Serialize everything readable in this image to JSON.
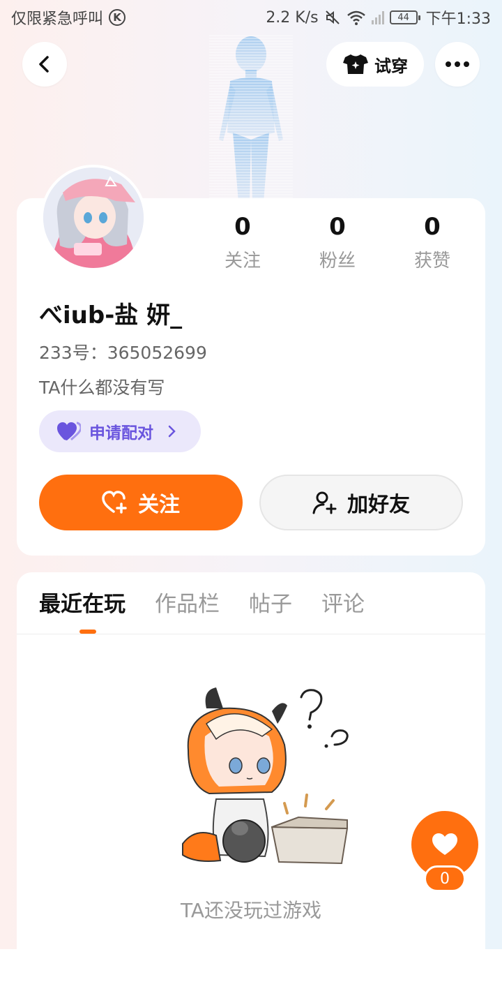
{
  "status_bar": {
    "left_text": "仅限紧急呼叫",
    "left_badge": "K",
    "speed": "2.2 K/s",
    "battery": "44",
    "time": "下午1:33"
  },
  "header": {
    "try_on_label": "试穿"
  },
  "profile": {
    "stats": [
      {
        "value": "0",
        "label": "关注"
      },
      {
        "value": "0",
        "label": "粉丝"
      },
      {
        "value": "0",
        "label": "获赞"
      }
    ],
    "username": "べiub-盐 妍_",
    "uid": "233号：365052699",
    "bio": "TA什么都没有写",
    "pair_label": "申请配对",
    "follow_label": "关注",
    "add_friend_label": "加好友"
  },
  "tabs": [
    {
      "label": "最近在玩",
      "active": true
    },
    {
      "label": "作品栏",
      "active": false
    },
    {
      "label": "帖子",
      "active": false
    },
    {
      "label": "评论",
      "active": false
    }
  ],
  "empty_state": {
    "text": "TA还没玩过游戏"
  },
  "like_fab": {
    "count": "0"
  },
  "colors": {
    "accent": "#ff6f0f",
    "pair_purple": "#6a55de",
    "pair_bg": "#ebe8fb"
  },
  "icons": [
    "back-arrow-icon",
    "tshirt-sparkle-icon",
    "more-dots-icon",
    "heart-pair-icon",
    "chevron-right-icon",
    "heart-plus-icon",
    "person-plus-icon",
    "heart-icon",
    "mute-icon",
    "wifi-icon",
    "signal-icon",
    "battery-icon"
  ]
}
